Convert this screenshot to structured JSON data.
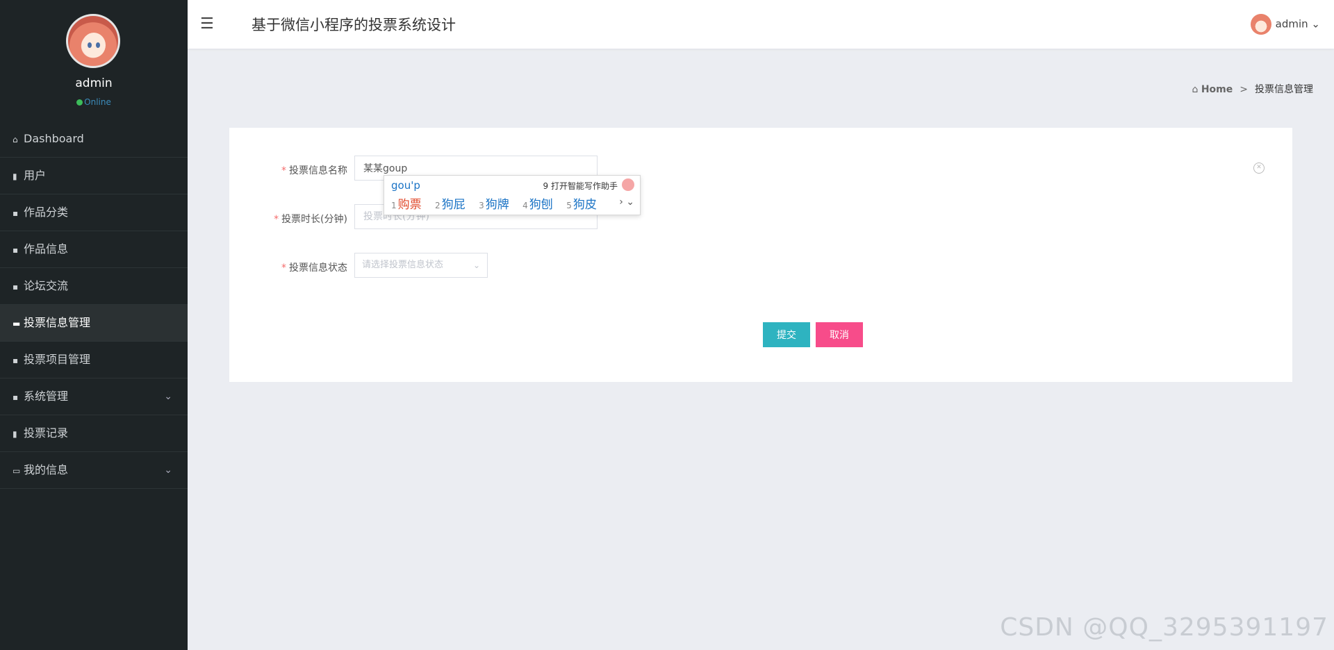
{
  "app_title": "基于微信小程序的投票系统设计",
  "sidebar": {
    "profile_name": "admin",
    "profile_status": "Online",
    "items": [
      {
        "label": "Dashboard",
        "icon": "⌂"
      },
      {
        "label": "用户",
        "icon": "▮"
      },
      {
        "label": "作品分类",
        "icon": "▪"
      },
      {
        "label": "作品信息",
        "icon": "▪"
      },
      {
        "label": "论坛交流",
        "icon": "▪"
      },
      {
        "label": "投票信息管理",
        "icon": "▬"
      },
      {
        "label": "投票项目管理",
        "icon": "▪"
      },
      {
        "label": "系统管理",
        "icon": "▪"
      },
      {
        "label": "投票记录",
        "icon": "▮"
      },
      {
        "label": "我的信息",
        "icon": "▭"
      }
    ]
  },
  "topbar": {
    "user": "admin"
  },
  "breadcrumb": {
    "home": "Home",
    "sep": ">",
    "current": "投票信息管理"
  },
  "form": {
    "name_label": "投票信息名称",
    "name_value": "某某goup",
    "duration_label": "投票时长(分钟)",
    "duration_placeholder": "投票时长(分钟)",
    "status_label": "投票信息状态",
    "status_placeholder": "请选择投票信息状态",
    "submit": "提交",
    "cancel": "取消"
  },
  "ime": {
    "composition": "gou'p",
    "assist": "9 打开智能写作助手",
    "candidates": [
      {
        "num": "1",
        "text": "购票"
      },
      {
        "num": "2",
        "text": "狗屁"
      },
      {
        "num": "3",
        "text": "狗牌"
      },
      {
        "num": "4",
        "text": "狗刨"
      },
      {
        "num": "5",
        "text": "狗皮"
      }
    ],
    "nav": "› ⌄"
  },
  "watermark": "CSDN @QQ_3295391197"
}
